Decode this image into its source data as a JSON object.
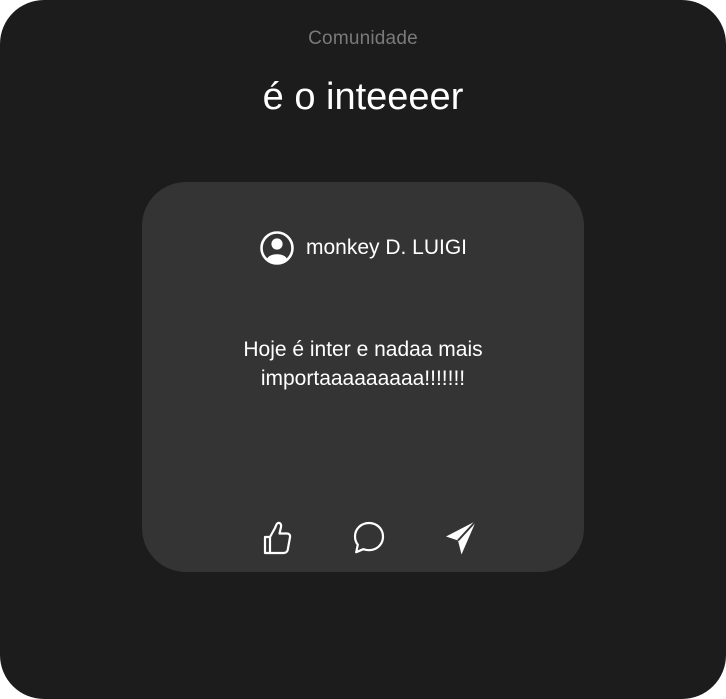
{
  "section": {
    "label": "Comunidade"
  },
  "page": {
    "title": "é o inteeeer"
  },
  "post": {
    "author": "monkey D. LUIGI",
    "avatar_icon": "user-circle-icon",
    "text": "Hoje é inter e nadaa mais importaaaaaaaaa!!!!!!!",
    "actions": [
      {
        "icon": "thumbs-up-icon"
      },
      {
        "icon": "comment-bubble-icon"
      },
      {
        "icon": "send-icon"
      }
    ]
  },
  "colors": {
    "background": "#1c1c1c",
    "card": "#343434",
    "muted_text": "#7a7a7a",
    "text": "#ffffff"
  }
}
